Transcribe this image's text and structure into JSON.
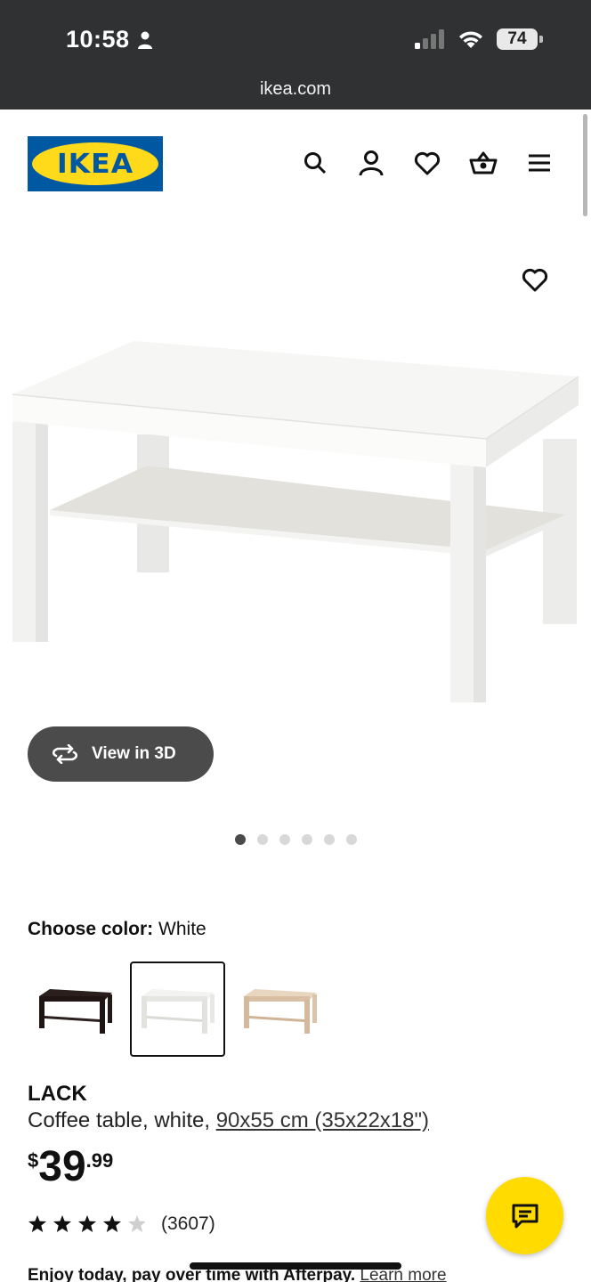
{
  "status_bar": {
    "time": "10:58",
    "battery": "74"
  },
  "browser": {
    "url": "ikea.com"
  },
  "header": {
    "logo_text": "IKEA",
    "icons": [
      "search-icon",
      "account-icon",
      "heart-icon",
      "basket-icon",
      "menu-icon"
    ]
  },
  "gallery": {
    "view_3d_label": "View in 3D",
    "dots_count": 6,
    "active_dot": 1
  },
  "color_chooser": {
    "label": "Choose color:",
    "selected": "White",
    "options": [
      "Black-brown",
      "White",
      "White stained oak effect"
    ]
  },
  "product": {
    "name": "LACK",
    "description": "Coffee table, white,",
    "size_link": "90x55 cm (35x22x18\")",
    "price_currency": "$",
    "price_int": "39",
    "price_dec": ".99",
    "rating": 4.5,
    "review_count": "(3607)"
  },
  "afterpay": {
    "text": "Enjoy today, pay over time with Afterpay.",
    "link": "Learn more"
  },
  "colors": {
    "ikea_blue": "#0058a3",
    "ikea_yellow": "#ffda1a",
    "chat_yellow": "#ffdb00"
  }
}
